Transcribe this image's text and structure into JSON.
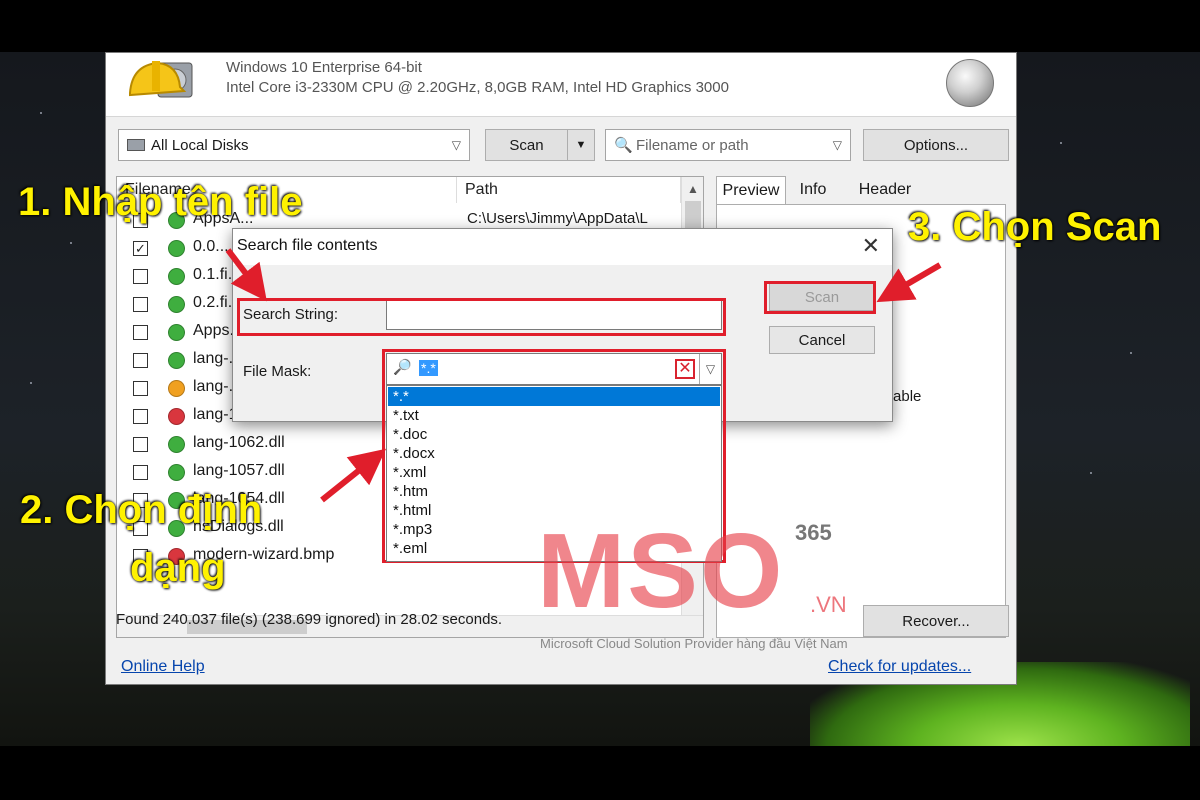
{
  "window": {
    "os_line": "Windows 10 Enterprise 64-bit",
    "hw_line": "Intel Core i3-2330M CPU @ 2.20GHz, 8,0GB RAM, Intel HD Graphics 3000"
  },
  "toolbar": {
    "drive_select": "All Local Disks",
    "scan_label": "Scan",
    "filter_placeholder": "Filename or path",
    "options_label": "Options..."
  },
  "file_list": {
    "columns": [
      "Filename",
      "Path"
    ],
    "rows": [
      {
        "name": "AppsA...",
        "path": "C:\\Users\\Jimmy\\AppData\\L",
        "checked": false,
        "status": "green"
      },
      {
        "name": "0.0...",
        "path": "",
        "checked": true,
        "status": "green"
      },
      {
        "name": "0.1.fi...",
        "path": "",
        "checked": false,
        "status": "green"
      },
      {
        "name": "0.2.fi...",
        "path": "",
        "checked": false,
        "status": "green"
      },
      {
        "name": "Apps...",
        "path": "",
        "checked": false,
        "status": "green"
      },
      {
        "name": "lang-...",
        "path": "",
        "checked": false,
        "status": "green"
      },
      {
        "name": "lang-...",
        "path": "",
        "checked": false,
        "status": "orange"
      },
      {
        "name": "lang-1059.dll",
        "path": "",
        "checked": false,
        "status": "red"
      },
      {
        "name": "lang-1062.dll",
        "path": "",
        "checked": false,
        "status": "green"
      },
      {
        "name": "lang-1057.dll",
        "path": "",
        "checked": false,
        "status": "green"
      },
      {
        "name": "lang-1054.dll",
        "path": "",
        "checked": false,
        "status": "green"
      },
      {
        "name": "nsDialogs.dll",
        "path": "",
        "checked": false,
        "status": "green"
      },
      {
        "name": "modern-wizard.bmp",
        "path": "",
        "checked": false,
        "status": "red"
      }
    ]
  },
  "preview": {
    "tabs": [
      "Preview",
      "Info",
      "Header"
    ],
    "active_tab": "Preview",
    "partial_text": "ailable",
    "faded_number": "365"
  },
  "status_bar": {
    "summary": "Found 240.037 file(s) (238.699 ignored) in 28.02 seconds.",
    "recover_label": "Recover...",
    "online_help": "Online Help",
    "check_updates": "Check for updates..."
  },
  "dialog": {
    "title": "Search file contents",
    "close_glyph": "✕",
    "search_label": "Search String:",
    "search_value": "",
    "mask_label": "File Mask:",
    "mask_value": "*.*",
    "scan_label": "Scan",
    "cancel_label": "Cancel",
    "mask_options": [
      "*.*",
      "*.txt",
      "*.doc",
      "*.docx",
      "*.xml",
      "*.htm",
      "*.html",
      "*.mp3",
      "*.eml"
    ]
  },
  "annotations": {
    "step1": "1. Nhập tên file",
    "step2_line1": "2. Chọn định",
    "step2_line2": "dạng",
    "step3": "3. Chọn Scan"
  },
  "watermark": {
    "brand": "MSO",
    "suffix": ".VN",
    "tagline": "Microsoft Cloud Solution Provider hàng đầu Việt Nam"
  },
  "colors": {
    "annotation_yellow": "#fff200",
    "highlight_red": "#e01e2b",
    "selection_blue": "#0078d7",
    "status_green": "#3fae3f",
    "status_orange": "#f0a020",
    "status_red": "#d9363e"
  }
}
